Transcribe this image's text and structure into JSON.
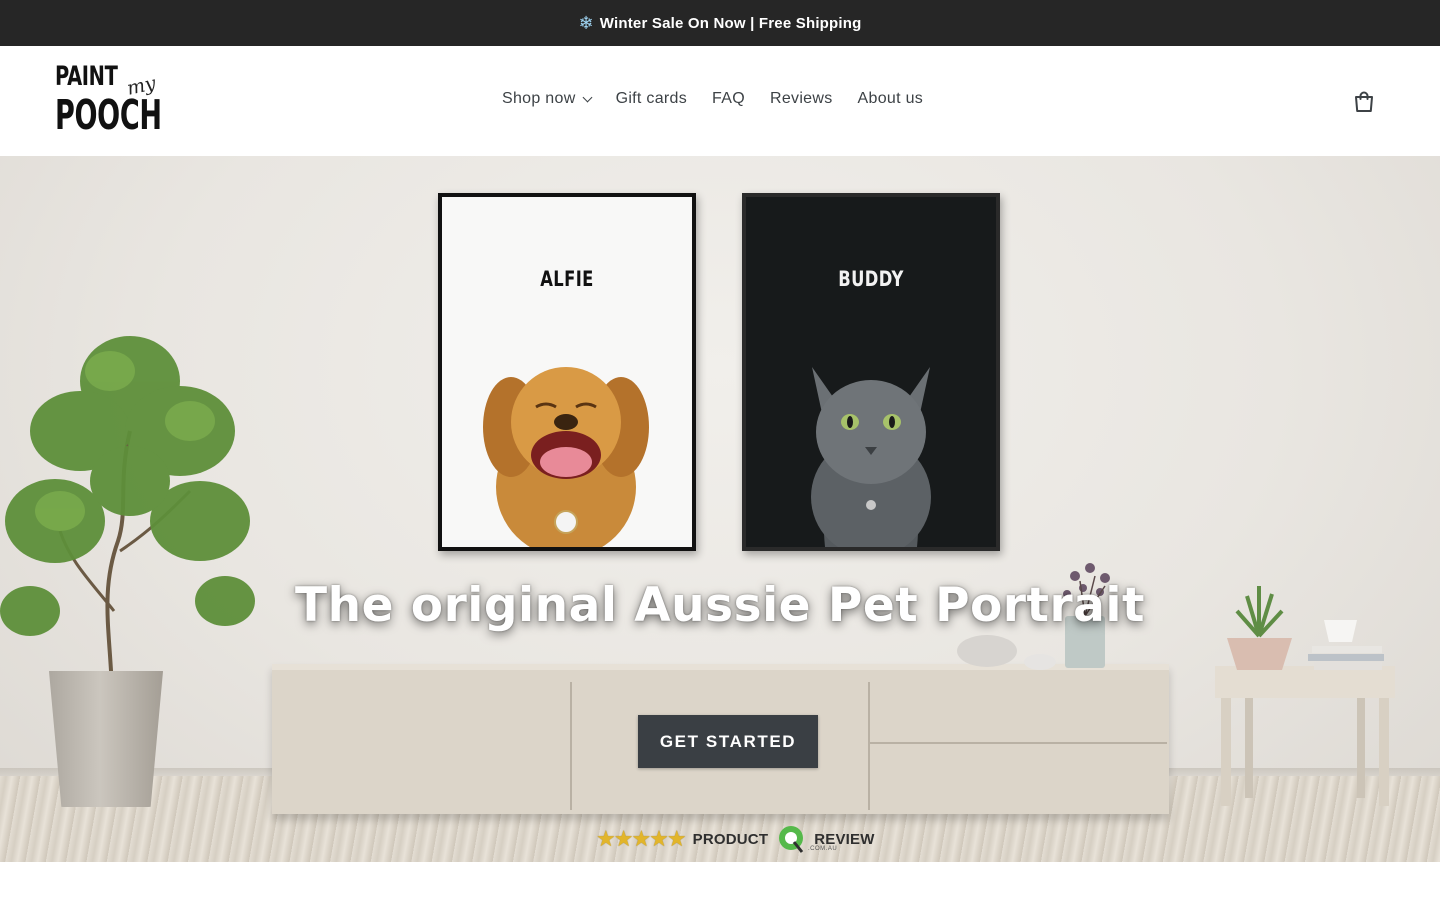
{
  "announcement": {
    "icon": "snowflake-icon",
    "icon_glyph": "❄",
    "text": "Winter Sale On Now | Free Shipping"
  },
  "logo": {
    "line1": "PAINT",
    "script": "my",
    "line2": "POOCH"
  },
  "nav": {
    "items": [
      {
        "label": "Shop now",
        "has_dropdown": true
      },
      {
        "label": "Gift cards"
      },
      {
        "label": "FAQ"
      },
      {
        "label": "Reviews"
      },
      {
        "label": "About us"
      }
    ],
    "cart_icon": "cart-icon"
  },
  "hero": {
    "portraits": [
      {
        "name": "ALFIE",
        "style": "white",
        "pet": "dog"
      },
      {
        "name": "BUDDY",
        "style": "black",
        "pet": "cat"
      }
    ],
    "headline": "The original Aussie Pet Portrait",
    "cta_label": "GET STARTED",
    "review_badge": {
      "stars": "★★★★★",
      "label_left": "PRODUCT",
      "label_right": "REVIEW",
      "sub": ".COM.AU"
    }
  },
  "colors": {
    "announcement_bg": "#262626",
    "cta_bg": "#3a3f44",
    "text": "#3d4246",
    "star": "#e2b52a"
  }
}
